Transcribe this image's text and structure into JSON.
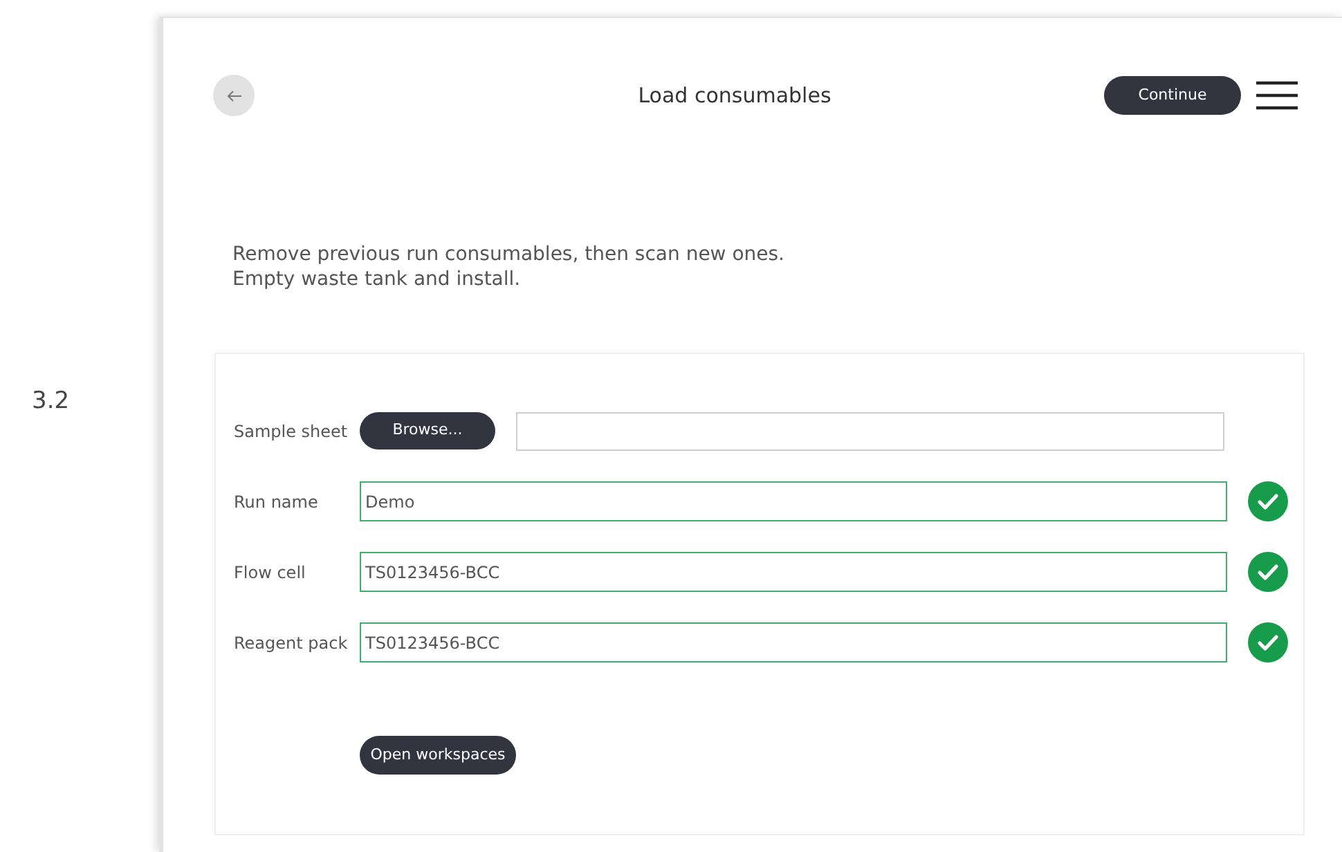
{
  "step_number": "3.2",
  "header": {
    "title": "Load consumables",
    "continue_button": "Continue"
  },
  "instructions": [
    "Remove previous run consumables, then scan new ones.",
    "Empty waste tank and install."
  ],
  "form": {
    "rows": [
      {
        "kind": "file",
        "label": "Sample sheet",
        "button": "Browse..."
      },
      {
        "kind": "text",
        "label": "Run name",
        "value": "Demo",
        "valid": true
      },
      {
        "kind": "text",
        "label": "Flow cell",
        "value": "TS0123456-BCC",
        "valid": true
      },
      {
        "kind": "text",
        "label": "Reagent pack",
        "value": "TS0123456-BCC",
        "valid": true
      }
    ],
    "open_button": "Open workspaces"
  }
}
